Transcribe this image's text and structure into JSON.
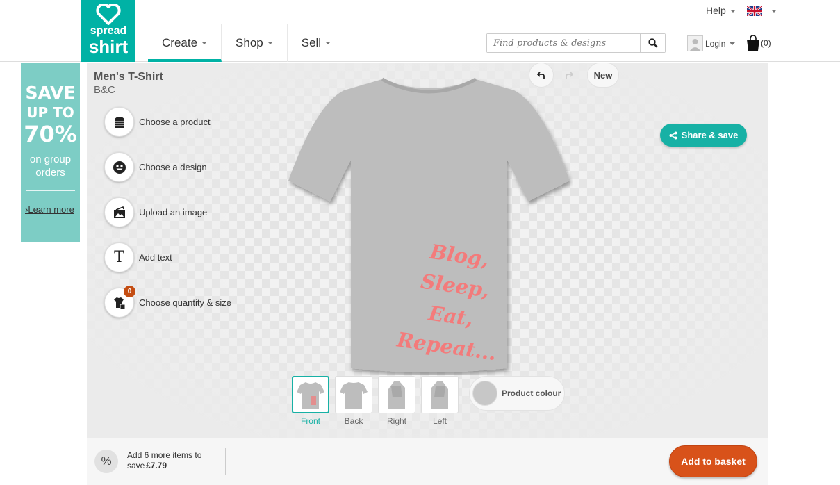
{
  "logo": {
    "line1": "spread",
    "line2": "shirt",
    "color": "#00b2a5"
  },
  "nav": [
    {
      "label": "Create",
      "active": true
    },
    {
      "label": "Shop",
      "active": false
    },
    {
      "label": "Sell",
      "active": false
    }
  ],
  "topbar": {
    "help": "Help",
    "language_icon": "uk-flag-icon"
  },
  "search": {
    "placeholder": "Find products & designs",
    "icon": "search-icon"
  },
  "account": {
    "login": "Login",
    "basket_count": "(0)"
  },
  "promo": {
    "line1": "SAVE",
    "line2": "UP TO",
    "line3": "70%",
    "line4": "on group",
    "line5": "orders",
    "link": "Learn more",
    "color": "#7dcdc5"
  },
  "product": {
    "title": "Men's T-Shirt",
    "brand": "B&C"
  },
  "steps": [
    {
      "label": "Choose a product",
      "icon": "shirt-stack-icon"
    },
    {
      "label": "Choose a design",
      "icon": "smiley-icon"
    },
    {
      "label": "Upload an image",
      "icon": "image-upload-icon"
    },
    {
      "label": "Add text",
      "icon": "text-icon"
    },
    {
      "label": "Choose quantity & size",
      "icon": "shirt-size-icon",
      "badge": "0"
    }
  ],
  "toolbar": {
    "undo_icon": "undo-icon",
    "redo_icon": "redo-icon",
    "new_label": "New"
  },
  "share": {
    "label": "Share & save",
    "color": "#17b1a5"
  },
  "design": {
    "lines": [
      "Blog,",
      "Sleep,",
      "Eat,",
      "Repeat..."
    ],
    "color": "#f37b7b"
  },
  "shirt": {
    "color": "#bdbdbd"
  },
  "views": [
    {
      "label": "Front",
      "active": true
    },
    {
      "label": "Back",
      "active": false
    },
    {
      "label": "Right",
      "active": false
    },
    {
      "label": "Left",
      "active": false
    }
  ],
  "product_colour": {
    "label": "Product colour"
  },
  "footer": {
    "percent_icon": "%",
    "save_text": "Add 6 more items to save",
    "save_amount": "£7.79",
    "add_to_basket": "Add to basket",
    "button_color": "#d8521a"
  }
}
